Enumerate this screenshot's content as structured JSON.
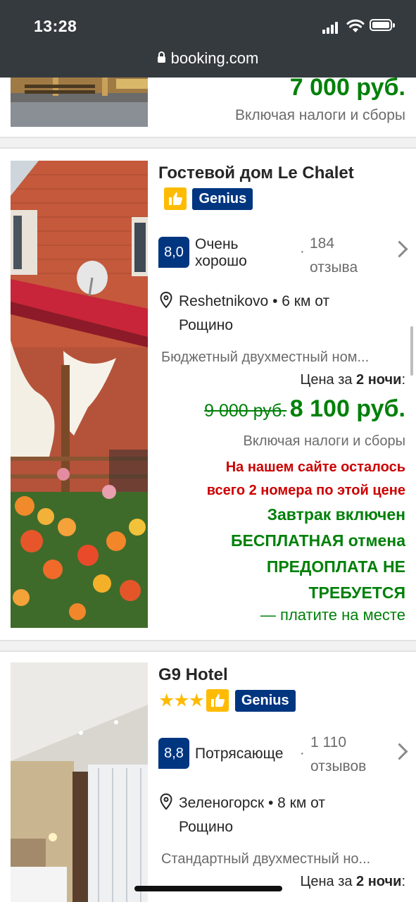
{
  "status_bar": {
    "time": "13:28",
    "url": "booking.com"
  },
  "prev_card": {
    "price": "7 000 руб.",
    "taxes": "Включая налоги и сборы"
  },
  "hotels": [
    {
      "name": "Гостевой дом Le Chalet",
      "genius_label": "Genius",
      "score": "8,0",
      "rating_line1": "Очень",
      "rating_line2": "хорошо",
      "dot": "·",
      "reviews_line1": "184",
      "reviews_line2": "отзыва",
      "location_line1": "Reshetnikovo • 6 км от",
      "location_line2": "Рощино",
      "room": "Бюджетный двухместный ном...",
      "price_for_prefix": "Цена за ",
      "price_for_nights": "2 ночи",
      "price_for_suffix": ":",
      "old_price": "9 000 руб.",
      "new_price": "8 100 руб.",
      "taxes": "Включая налоги и сборы",
      "scarcity_line1": "На нашем сайте осталось",
      "scarcity_line2": "всего 2 номера по этой цене",
      "breakfast": "Завтрак включен",
      "cancel": "БЕСПЛАТНАЯ отмена",
      "prepay_line1": "ПРЕДОПЛАТА НЕ",
      "prepay_line2": "ТРЕБУЕТСЯ",
      "pay_at_property": "— платите на месте"
    },
    {
      "name": "G9 Hotel",
      "genius_label": "Genius",
      "stars": "★★★",
      "score": "8,8",
      "rating_line1": "Потрясающе",
      "dot": "·",
      "reviews_line1": "1 110",
      "reviews_line2": "отзывов",
      "location_line1": "Зеленогорск • 8 км от",
      "location_line2": "Рощино",
      "room": "Стандартный двухместный но...",
      "price_for_prefix": "Цена за ",
      "price_for_nights": "2 ночи",
      "price_for_suffix": ":"
    }
  ],
  "colors": {
    "brand_blue": "#003580",
    "price_green": "#008009",
    "scarcity_red": "#cc0000",
    "thumb_yellow": "#febb02",
    "status_bar": "#353a3f"
  }
}
